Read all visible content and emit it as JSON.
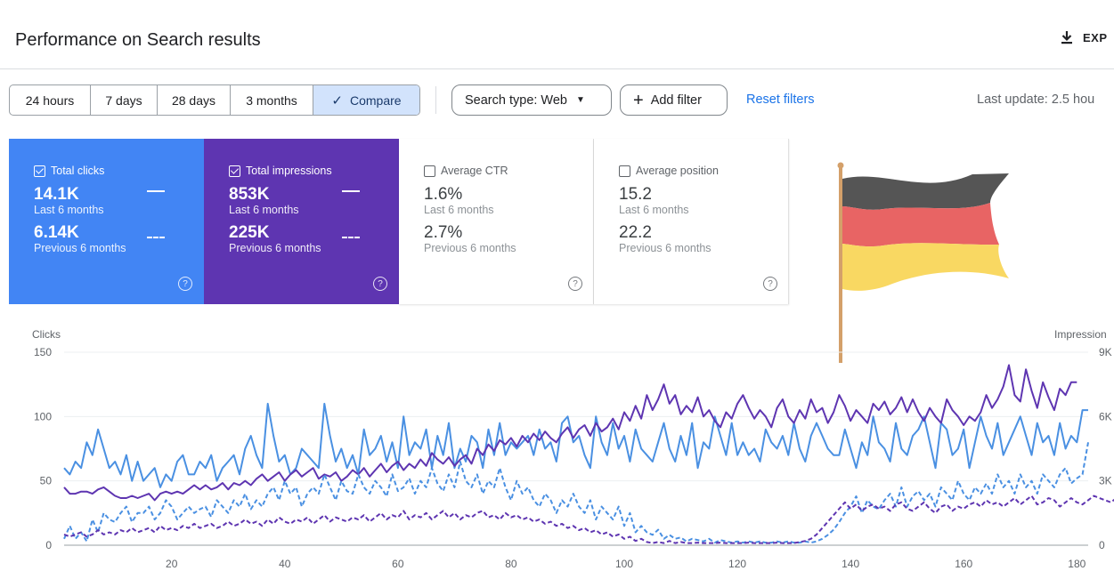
{
  "header": {
    "title": "Performance on Search results",
    "export_label": "EXP"
  },
  "date_range": {
    "options": [
      "24 hours",
      "7 days",
      "28 days",
      "3 months",
      "Compare"
    ],
    "active": "Compare"
  },
  "filters": {
    "search_type": "Search type: Web",
    "add_filter": "Add filter",
    "reset": "Reset filters"
  },
  "last_update": "Last update: 2.5 hou",
  "metrics": [
    {
      "label": "Total clicks",
      "checked": true,
      "current": "14.1K",
      "current_label": "Last 6 months",
      "previous": "6.14K",
      "previous_label": "Previous 6 months",
      "color": "#4285f4"
    },
    {
      "label": "Total impressions",
      "checked": true,
      "current": "853K",
      "current_label": "Last 6 months",
      "previous": "225K",
      "previous_label": "Previous 6 months",
      "color": "#5e35b1"
    },
    {
      "label": "Average CTR",
      "checked": false,
      "current": "1.6%",
      "current_label": "Last 6 months",
      "previous": "2.7%",
      "previous_label": "Previous 6 months"
    },
    {
      "label": "Average position",
      "checked": false,
      "current": "15.2",
      "current_label": "Last 6 months",
      "previous": "22.2",
      "previous_label": "Previous 6 months"
    }
  ],
  "flag_colors": [
    "#555555",
    "#e86464",
    "#f9d862"
  ],
  "chart_data": {
    "type": "line",
    "ylabel": "Clicks",
    "y2label": "Impression",
    "ylim": [
      0,
      150
    ],
    "y_ticks": [
      "0",
      "50",
      "100",
      "150"
    ],
    "y2_ticks": [
      "0",
      "3K",
      "6K",
      "9K"
    ],
    "x_ticks": [
      "20",
      "40",
      "60",
      "80",
      "100",
      "120",
      "140",
      "160",
      "180"
    ],
    "xlim": [
      1,
      182
    ],
    "grid": true,
    "colors": {
      "clicks": "#4a90e2",
      "impressions": "#5e35b1"
    },
    "series": [
      {
        "key": "clicks_current",
        "axis": "left",
        "dashed": false,
        "values": [
          60,
          55,
          65,
          60,
          80,
          70,
          90,
          75,
          60,
          65,
          55,
          70,
          50,
          65,
          50,
          55,
          60,
          45,
          55,
          50,
          65,
          70,
          55,
          55,
          65,
          60,
          70,
          50,
          60,
          65,
          70,
          55,
          75,
          85,
          70,
          60,
          110,
          85,
          65,
          70,
          55,
          60,
          75,
          70,
          65,
          60,
          110,
          85,
          65,
          75,
          60,
          70,
          55,
          90,
          70,
          75,
          85,
          65,
          80,
          60,
          100,
          70,
          80,
          75,
          90,
          60,
          85,
          70,
          95,
          60,
          75,
          65,
          85,
          80,
          60,
          90,
          70,
          95,
          70,
          80,
          75,
          80,
          85,
          70,
          90,
          75,
          80,
          65,
          95,
          100,
          80,
          85,
          70,
          60,
          100,
          80,
          70,
          95,
          75,
          85,
          65,
          90,
          75,
          70,
          65,
          80,
          95,
          75,
          65,
          85,
          70,
          95,
          60,
          80,
          75,
          100,
          85,
          70,
          95,
          70,
          80,
          70,
          75,
          65,
          90,
          80,
          75,
          85,
          70,
          95,
          75,
          65,
          85,
          95,
          85,
          75,
          70,
          70,
          90,
          75,
          60,
          80,
          70,
          100,
          80,
          75,
          65,
          95,
          75,
          70,
          85,
          90,
          100,
          80,
          60,
          95,
          90,
          70,
          75,
          90,
          60,
          80,
          100,
          85,
          75,
          95,
          70,
          80,
          90,
          100,
          85,
          70,
          95,
          80,
          85,
          70,
          95,
          75,
          85,
          80,
          105,
          105
        ]
      },
      {
        "key": "impressions_current",
        "axis": "right",
        "dashed": false,
        "values": [
          2.7,
          2.4,
          2.4,
          2.5,
          2.5,
          2.4,
          2.6,
          2.7,
          2.5,
          2.3,
          2.2,
          2.2,
          2.3,
          2.2,
          2.3,
          2.4,
          2.1,
          2.4,
          2.5,
          2.4,
          2.5,
          2.4,
          2.6,
          2.8,
          2.6,
          2.8,
          2.6,
          2.7,
          2.9,
          2.6,
          2.9,
          2.8,
          3.0,
          2.8,
          3.1,
          3.3,
          3.0,
          3.2,
          3.4,
          3.0,
          3.3,
          3.5,
          3.2,
          3.4,
          3.6,
          3.1,
          3.3,
          3.2,
          3.4,
          3.0,
          3.2,
          3.5,
          3.3,
          3.6,
          3.2,
          3.5,
          3.8,
          3.4,
          3.7,
          3.9,
          3.5,
          3.8,
          3.6,
          4.0,
          3.7,
          4.3,
          4.0,
          3.8,
          4.1,
          3.7,
          4.0,
          4.2,
          3.8,
          4.5,
          4.2,
          4.7,
          4.4,
          4.9,
          4.7,
          5.0,
          4.6,
          5.1,
          4.8,
          5.2,
          4.9,
          5.3,
          5.0,
          4.8,
          5.2,
          5.5,
          5.0,
          5.4,
          5.6,
          5.1,
          5.7,
          5.3,
          5.5,
          5.9,
          5.4,
          6.2,
          5.8,
          6.5,
          5.9,
          7.0,
          6.3,
          6.8,
          7.5,
          6.6,
          7.0,
          6.1,
          6.5,
          6.2,
          6.9,
          6.0,
          6.3,
          5.8,
          5.5,
          6.2,
          5.9,
          6.6,
          7.0,
          6.4,
          5.9,
          6.3,
          6.0,
          5.5,
          6.4,
          6.8,
          6.0,
          5.7,
          6.3,
          5.9,
          6.8,
          6.2,
          6.4,
          5.7,
          6.2,
          7.0,
          6.5,
          5.8,
          6.3,
          6.0,
          5.7,
          6.6,
          6.3,
          6.7,
          6.1,
          6.4,
          6.9,
          6.2,
          6.8,
          6.2,
          5.8,
          6.4,
          6.0,
          5.7,
          6.8,
          6.3,
          6.0,
          5.6,
          6.0,
          5.8,
          6.2,
          7.0,
          6.4,
          6.8,
          7.4,
          8.4,
          7.0,
          6.7,
          8.2,
          7.2,
          6.4,
          7.6,
          6.9,
          6.3,
          7.3,
          7.0,
          7.6,
          7.6
        ]
      },
      {
        "key": "clicks_previous",
        "axis": "left",
        "dashed": true,
        "values": [
          5,
          15,
          5,
          10,
          3,
          20,
          10,
          25,
          20,
          18,
          25,
          30,
          18,
          25,
          25,
          30,
          20,
          25,
          35,
          30,
          20,
          25,
          30,
          25,
          28,
          30,
          22,
          35,
          30,
          25,
          35,
          30,
          40,
          28,
          35,
          30,
          40,
          45,
          35,
          50,
          40,
          45,
          30,
          40,
          45,
          40,
          55,
          45,
          35,
          50,
          42,
          40,
          55,
          45,
          40,
          50,
          45,
          38,
          55,
          42,
          45,
          52,
          40,
          50,
          45,
          60,
          48,
          42,
          55,
          45,
          65,
          50,
          45,
          55,
          40,
          50,
          45,
          60,
          45,
          35,
          50,
          40,
          45,
          35,
          30,
          40,
          35,
          25,
          35,
          30,
          40,
          30,
          25,
          35,
          20,
          30,
          25,
          20,
          30,
          15,
          25,
          10,
          15,
          10,
          8,
          12,
          5,
          8,
          5,
          6,
          3,
          5,
          4,
          3,
          5,
          2,
          4,
          3,
          2,
          3,
          2,
          3,
          2,
          3,
          2,
          2,
          3,
          2,
          3,
          2,
          2,
          3,
          2,
          3,
          5,
          8,
          12,
          18,
          25,
          30,
          38,
          25,
          35,
          30,
          28,
          35,
          40,
          30,
          45,
          30,
          38,
          42,
          35,
          40,
          30,
          45,
          40,
          35,
          50,
          40,
          35,
          45,
          40,
          48,
          40,
          55,
          45,
          50,
          40,
          55,
          45,
          50,
          40,
          55,
          50,
          45,
          55,
          60,
          48,
          52,
          55,
          80
        ]
      },
      {
        "key": "impressions_previous",
        "axis": "right",
        "dashed": true,
        "values": [
          0.5,
          0.4,
          0.5,
          0.6,
          0.4,
          0.5,
          0.7,
          0.5,
          0.6,
          0.5,
          0.7,
          0.6,
          0.8,
          0.6,
          0.7,
          0.8,
          0.6,
          0.9,
          0.7,
          0.8,
          0.7,
          0.9,
          0.8,
          1.0,
          0.8,
          0.9,
          1.0,
          0.8,
          0.9,
          1.1,
          0.9,
          1.0,
          1.2,
          1.0,
          1.1,
          0.9,
          1.2,
          1.0,
          1.3,
          1.1,
          1.0,
          1.2,
          1.1,
          1.3,
          1.0,
          1.2,
          1.4,
          1.1,
          1.3,
          1.2,
          1.1,
          1.3,
          1.2,
          1.4,
          1.1,
          1.3,
          1.5,
          1.2,
          1.4,
          1.3,
          1.6,
          1.2,
          1.4,
          1.3,
          1.5,
          1.2,
          1.4,
          1.6,
          1.3,
          1.5,
          1.2,
          1.4,
          1.3,
          1.5,
          1.6,
          1.3,
          1.4,
          1.2,
          1.5,
          1.3,
          1.4,
          1.2,
          1.3,
          1.1,
          1.2,
          1.0,
          1.1,
          0.9,
          1.0,
          0.8,
          0.9,
          0.7,
          0.8,
          0.6,
          0.7,
          0.5,
          0.6,
          0.4,
          0.5,
          0.3,
          0.4,
          0.2,
          0.3,
          0.15,
          0.1,
          0.15,
          0.1,
          0.2,
          0.1,
          0.15,
          0.1,
          0.1,
          0.12,
          0.1,
          0.1,
          0.1,
          0.12,
          0.1,
          0.1,
          0.1,
          0.1,
          0.12,
          0.1,
          0.1,
          0.1,
          0.1,
          0.12,
          0.1,
          0.1,
          0.1,
          0.15,
          0.2,
          0.3,
          0.5,
          0.8,
          1.1,
          1.4,
          1.7,
          2.0,
          1.7,
          1.9,
          1.6,
          1.8,
          1.9,
          1.7,
          1.8,
          1.6,
          1.9,
          2.0,
          1.7,
          1.6,
          1.8,
          2.0,
          1.7,
          1.5,
          1.8,
          1.9,
          1.6,
          1.8,
          1.7,
          1.9,
          2.0,
          1.8,
          2.1,
          1.9,
          2.0,
          1.8,
          2.0,
          2.2,
          1.9,
          2.1,
          2.3,
          1.9,
          2.0,
          2.2,
          2.1,
          1.8,
          2.0,
          2.2,
          2.0,
          1.9,
          2.1,
          2.3,
          2.2,
          2.1,
          2.0,
          2.2,
          1.9,
          2.3,
          2.6
        ]
      }
    ]
  }
}
